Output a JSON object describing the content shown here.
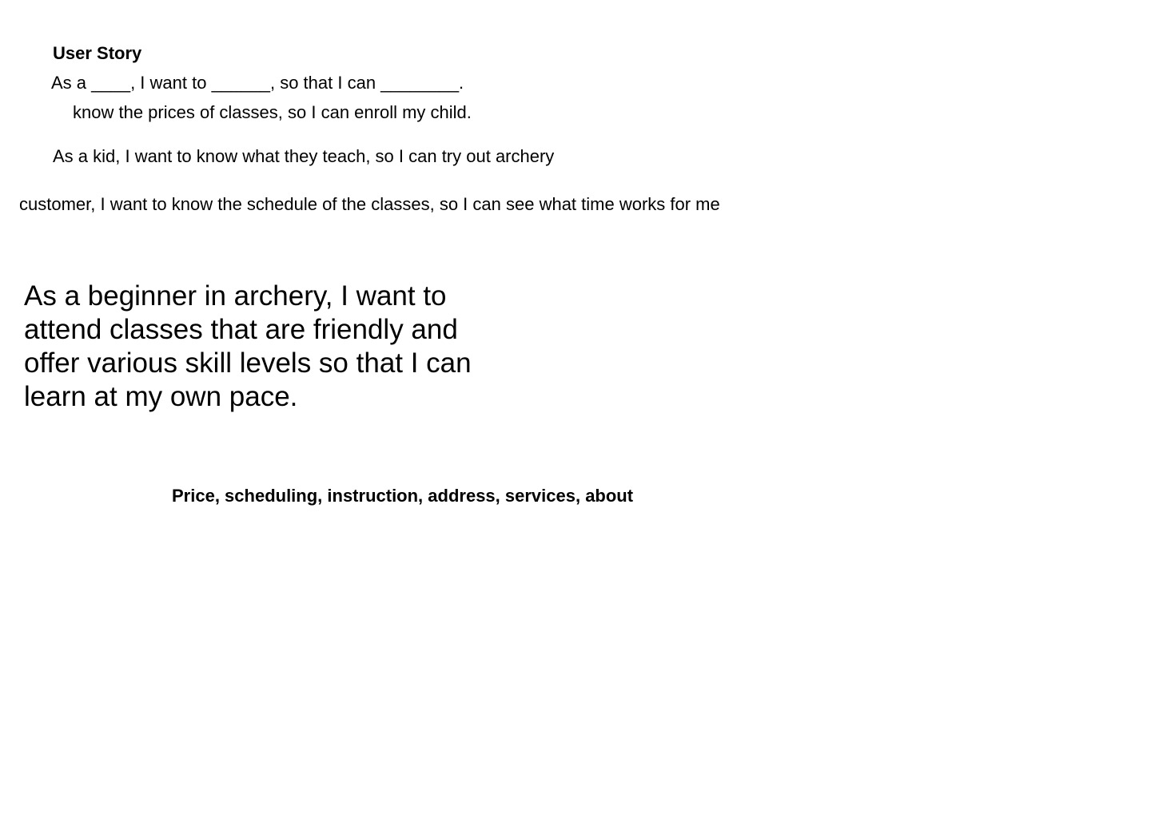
{
  "document": {
    "heading": "User Story",
    "template": "As a ____, I want to ______, so that I can ________.",
    "stories": {
      "parent": "know the prices of classes, so I can enroll my child.",
      "kid": "As a kid, I want to know what they teach, so I can try out archery",
      "customer": "customer,  I want to know the schedule of the classes, so I can see what time works for me",
      "beginner": "As a beginner in archery, I want to attend classes that are friendly and offer various skill levels so that I can learn at my own pace."
    },
    "keywords": "Price, scheduling, instruction, address, services, about"
  }
}
